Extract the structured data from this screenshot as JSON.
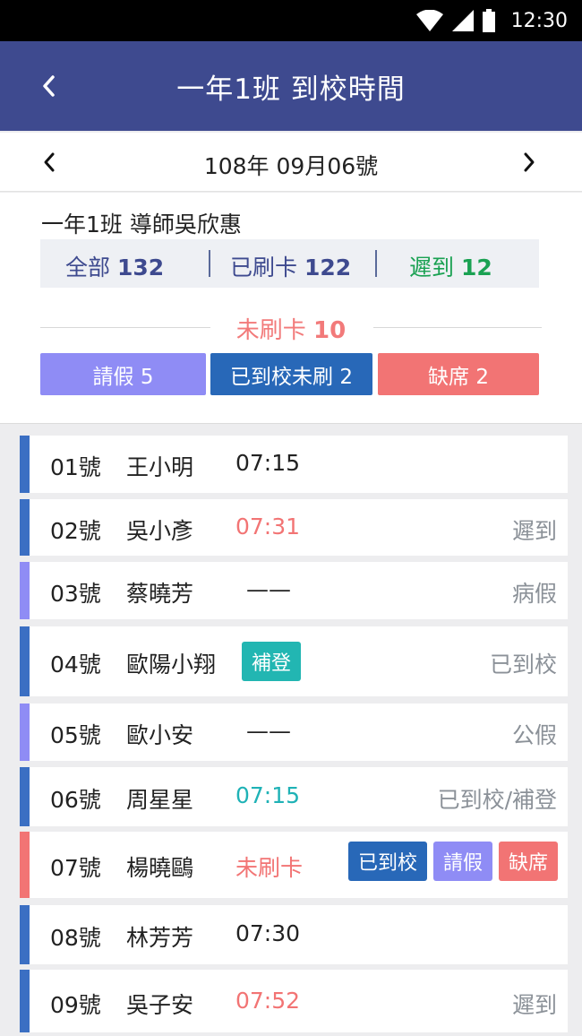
{
  "status_bar": {
    "time": "12:30",
    "icons": [
      "wifi-icon",
      "signal-icon",
      "battery-icon"
    ]
  },
  "header": {
    "title": "一年1班 到校時間",
    "back_icon": "chevron-left-icon"
  },
  "date_bar": {
    "date": "108年  09月06號",
    "prev_icon": "chevron-left-icon",
    "next_icon": "chevron-right-icon"
  },
  "summary": {
    "class_teacher": "一年1班  導師吳欣惠",
    "total_label": "全部",
    "total_count": "132",
    "swiped_label": "已刷卡",
    "swiped_count": "122",
    "late_label": "遲到",
    "late_count": "12",
    "unswiped_label": "未刷卡",
    "unswiped_count": "10",
    "buttons": [
      {
        "label": "請假 5"
      },
      {
        "label": "已到校未刷 2"
      },
      {
        "label": "缺席 2"
      }
    ]
  },
  "students": [
    {
      "num": "01號",
      "name": "王小明",
      "time": "07:15",
      "status": ""
    },
    {
      "num": "02號",
      "name": "吳小彥",
      "time": "07:31",
      "status": "遲到"
    },
    {
      "num": "03號",
      "name": "蔡曉芳",
      "time": "——",
      "status": "病假"
    },
    {
      "num": "04號",
      "name": "歐陽小翔",
      "tag": "補登",
      "status": "已到校"
    },
    {
      "num": "05號",
      "name": "歐小安",
      "time": "——",
      "status": "公假"
    },
    {
      "num": "06號",
      "name": "周星星",
      "time": "07:15",
      "status": "已到校/補登"
    },
    {
      "num": "07號",
      "name": "楊曉鷗",
      "time": "未刷卡",
      "actions": [
        "已到校",
        "請假",
        "缺席"
      ]
    },
    {
      "num": "08號",
      "name": "林芳芳",
      "time": "07:30",
      "status": ""
    },
    {
      "num": "09號",
      "name": "吳子安",
      "time": "07:52",
      "status": "遲到"
    }
  ],
  "colors": {
    "header": "#3e4a8f",
    "on_time_bar": "#3b6fc3",
    "leave_bar": "#8f8cf5",
    "absent_bar": "#f27474",
    "late_text": "#f27474",
    "makeup_time": "#1fb2b6",
    "late_count": "#1aa152",
    "leave_btn": "#8f8cf5",
    "arrived_btn": "#2868b8",
    "absent_btn": "#f27474",
    "makeup_tag": "#22b6b2"
  }
}
